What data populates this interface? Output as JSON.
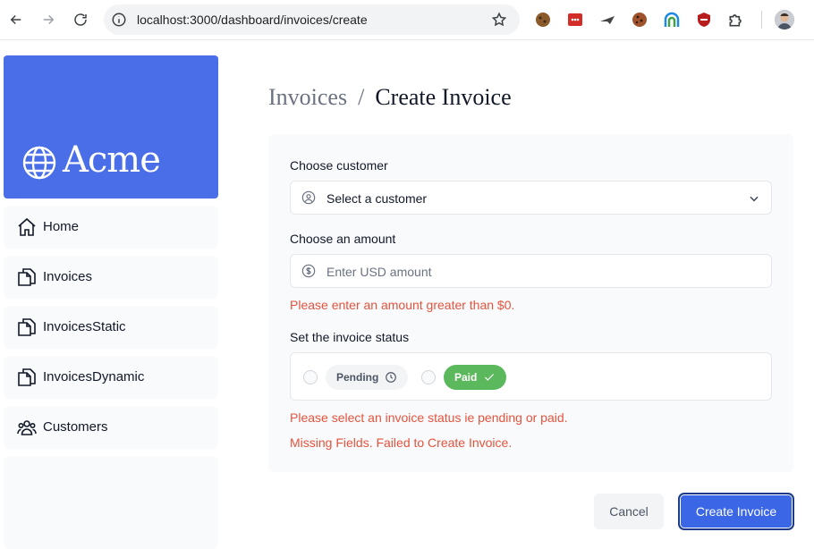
{
  "browser": {
    "url": "localhost:3000/dashboard/invoices/create"
  },
  "sidebar": {
    "logo_text": "Acme",
    "items": [
      {
        "label": "Home",
        "icon": "home-icon"
      },
      {
        "label": "Invoices",
        "icon": "document-icon"
      },
      {
        "label": "InvoicesStatic",
        "icon": "document-icon"
      },
      {
        "label": "InvoicesDynamic",
        "icon": "document-icon"
      },
      {
        "label": "Customers",
        "icon": "users-icon"
      }
    ]
  },
  "breadcrumb": {
    "parent": "Invoices",
    "separator": "/",
    "current": "Create Invoice"
  },
  "form": {
    "customer_label": "Choose customer",
    "customer_select_value": "Select a customer",
    "amount_label": "Choose an amount",
    "amount_placeholder": "Enter USD amount",
    "amount_error": "Please enter an amount greater than $0.",
    "status_label": "Set the invoice status",
    "status_options": [
      {
        "label": "Pending",
        "icon": "clock-icon"
      },
      {
        "label": "Paid",
        "icon": "check-icon"
      }
    ],
    "status_error": "Please select an invoice status ie pending or paid.",
    "form_error": "Missing Fields. Failed to Create Invoice."
  },
  "actions": {
    "cancel_label": "Cancel",
    "create_label": "Create Invoice"
  },
  "colors": {
    "brand": "#4a6ee8",
    "primary_button": "#3b66e6",
    "error": "#e5533d",
    "paid_green": "#5cb85c"
  }
}
